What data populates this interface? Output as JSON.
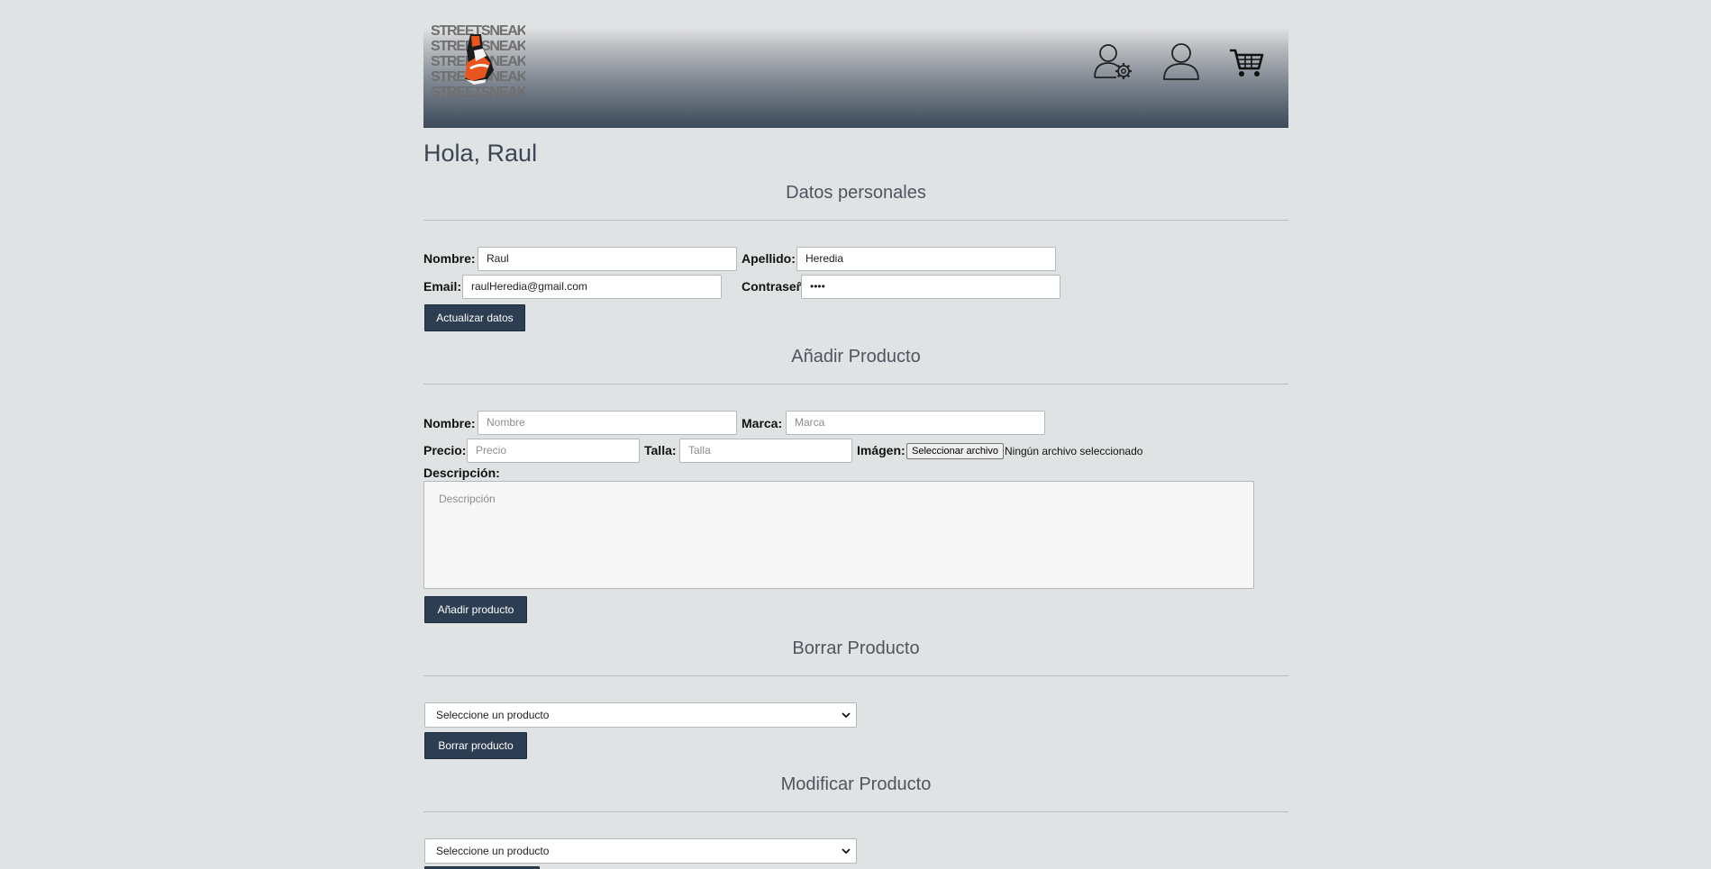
{
  "header": {
    "logo_text": [
      "STREETSNEAKERS",
      "STREETSNEAKERS",
      "STREETSNEAKERS",
      "STREETSNEAKERS",
      "STREETSNEAKERS"
    ],
    "icons": [
      "admin-user-gear-icon",
      "user-icon",
      "cart-icon"
    ]
  },
  "greeting": "Hola, Raul",
  "personal": {
    "title": "Datos personales",
    "nombre_label": "Nombre:",
    "nombre_value": "Raul",
    "apellido_label": "Apellido:",
    "apellido_value": "Heredia",
    "email_label": "Email:",
    "email_value": "raulHeredia@gmail.com",
    "password_label": "Contraseña:",
    "password_value": "••••",
    "button": "Actualizar datos"
  },
  "add_product": {
    "title": "Añadir Producto",
    "nombre_label": "Nombre:",
    "nombre_placeholder": "Nombre",
    "marca_label": "Marca:",
    "marca_placeholder": "Marca",
    "precio_label": "Precio:",
    "precio_placeholder": "Precio",
    "talla_label": "Talla:",
    "talla_placeholder": "Talla",
    "imagen_label": "Imágen:",
    "file_button": "Seleccionar archivo",
    "file_status": "Ningún archivo seleccionado",
    "descripcion_label": "Descripción:",
    "descripcion_placeholder": "Descripción",
    "button": "Añadir producto"
  },
  "delete_product": {
    "title": "Borrar Producto",
    "select_value": "Seleccione un producto",
    "button": "Borrar producto"
  },
  "modify_product": {
    "title": "Modificar Producto",
    "select_value": "Seleccione un producto"
  }
}
